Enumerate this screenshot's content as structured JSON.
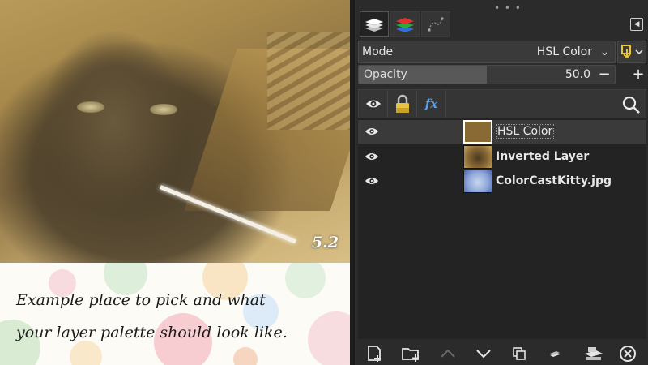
{
  "image": {
    "label": "5.2"
  },
  "caption": {
    "line1": "Example place to pick and what",
    "line2": "your layer palette should look like."
  },
  "panel": {
    "tabs": [
      {
        "icon": "layers-icon",
        "active": true
      },
      {
        "icon": "channels-icon",
        "active": false
      },
      {
        "icon": "paths-icon",
        "active": false
      }
    ],
    "tab_menu_icon": "tab-menu-icon",
    "mode": {
      "label": "Mode",
      "value": "HSL Color"
    },
    "opacity": {
      "label": "Opacity",
      "value": "50.0",
      "fraction": 0.5,
      "minus": "−",
      "plus": "+"
    },
    "header_icons": [
      "visibility-icon",
      "lock-icon",
      "effects-icon",
      "search-icon"
    ],
    "fx_label": "fx",
    "layers": [
      {
        "name": "HSL Color",
        "visible": true,
        "selected": true,
        "thumb": "#8a6a34"
      },
      {
        "name": "Inverted Layer",
        "visible": true,
        "selected": false,
        "thumb": "#7a5a2a"
      },
      {
        "name": "ColorCastKitty.jpg",
        "visible": true,
        "selected": false,
        "thumb": "#8fa7d8"
      }
    ],
    "bottom_actions": [
      "new-layer-icon",
      "new-layer-group-icon",
      "raise-layer-icon",
      "lower-layer-icon",
      "duplicate-layer-icon",
      "merge-down-icon",
      "anchor-layer-icon",
      "delete-layer-icon"
    ]
  },
  "colors": {
    "panel_bg": "#2b2b2b",
    "list_bg": "#232323",
    "accent_yellow": "#e8c43a"
  }
}
